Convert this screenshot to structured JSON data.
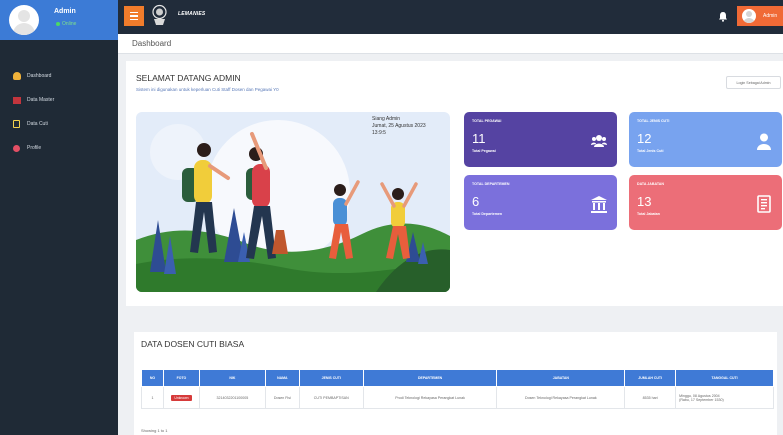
{
  "sidebar": {
    "user_name": "Admin",
    "user_status": "Online",
    "items": [
      {
        "label": "Dashboard",
        "icon": "dashboard-icon"
      },
      {
        "label": "Data Master",
        "icon": "database-icon"
      },
      {
        "label": "Data Cuti",
        "icon": "calendar-icon"
      },
      {
        "label": "Profile",
        "icon": "user-icon"
      }
    ]
  },
  "topbar": {
    "brand": "LEMANIES",
    "user_label": "Admin",
    "accent": "#f17c2b"
  },
  "breadcrumb": {
    "title": "Dashboard"
  },
  "welcome": {
    "title": "SELAMAT DATANG ADMIN",
    "subtitle": "Sistem ini digunakan untuk keperluan Cuti Staff Dosen dan Pegawai Y0",
    "logout_label": "Login Sebagai Admin"
  },
  "banner": {
    "greeting": "Siang Admin",
    "date": "Jumat, 25 Agustus 2023",
    "time": "13:9:5"
  },
  "cards": [
    {
      "title": "TOTAL PEGAWAI",
      "value": "11",
      "sub": "Total Pegawai",
      "icon": "users-icon",
      "color": "#5543a2"
    },
    {
      "title": "TOTAL JENIS CUTI",
      "value": "12",
      "sub": "Total Jenis Cuti",
      "icon": "user-icon",
      "color": "#78a3ef"
    },
    {
      "title": "TOTAL DEPARTEMEN",
      "value": "6",
      "sub": "Total Departemen",
      "icon": "building-icon",
      "color": "#7b70dc"
    },
    {
      "title": "DATA JABATAN",
      "value": "13",
      "sub": "Total Jabatan",
      "icon": "document-icon",
      "color": "#ec6e78"
    }
  ],
  "table": {
    "title": "DATA DOSEN CUTI BIASA",
    "headers": [
      "NO",
      "FOTO",
      "NIK",
      "NAMA",
      "JENIS CUTI",
      "DEPARTEMEN",
      "JABATAN",
      "JUMLAH CUTI",
      "TANGGAL CUTI"
    ],
    "rows": [
      {
        "no": "1",
        "foto": "Unknown",
        "nik": "3214032201100005",
        "nama": "Dosen Fisi",
        "jenis_cuti": "CUTI PEMBAPTISAN",
        "departemen": "Prodi Teknologi Rekayasa Perangkat Lunak",
        "jabatan": "Dosen Teknologi Rekayasa Perangkat Lunak",
        "jumlah_cuti": "8535 hari",
        "tanggal_cuti_1": "Minggu, 08 Agustus 2004",
        "tanggal_cuti_2": "(Rabu, 17 September 1530)"
      }
    ],
    "showing": "Showing 1 to 1"
  }
}
